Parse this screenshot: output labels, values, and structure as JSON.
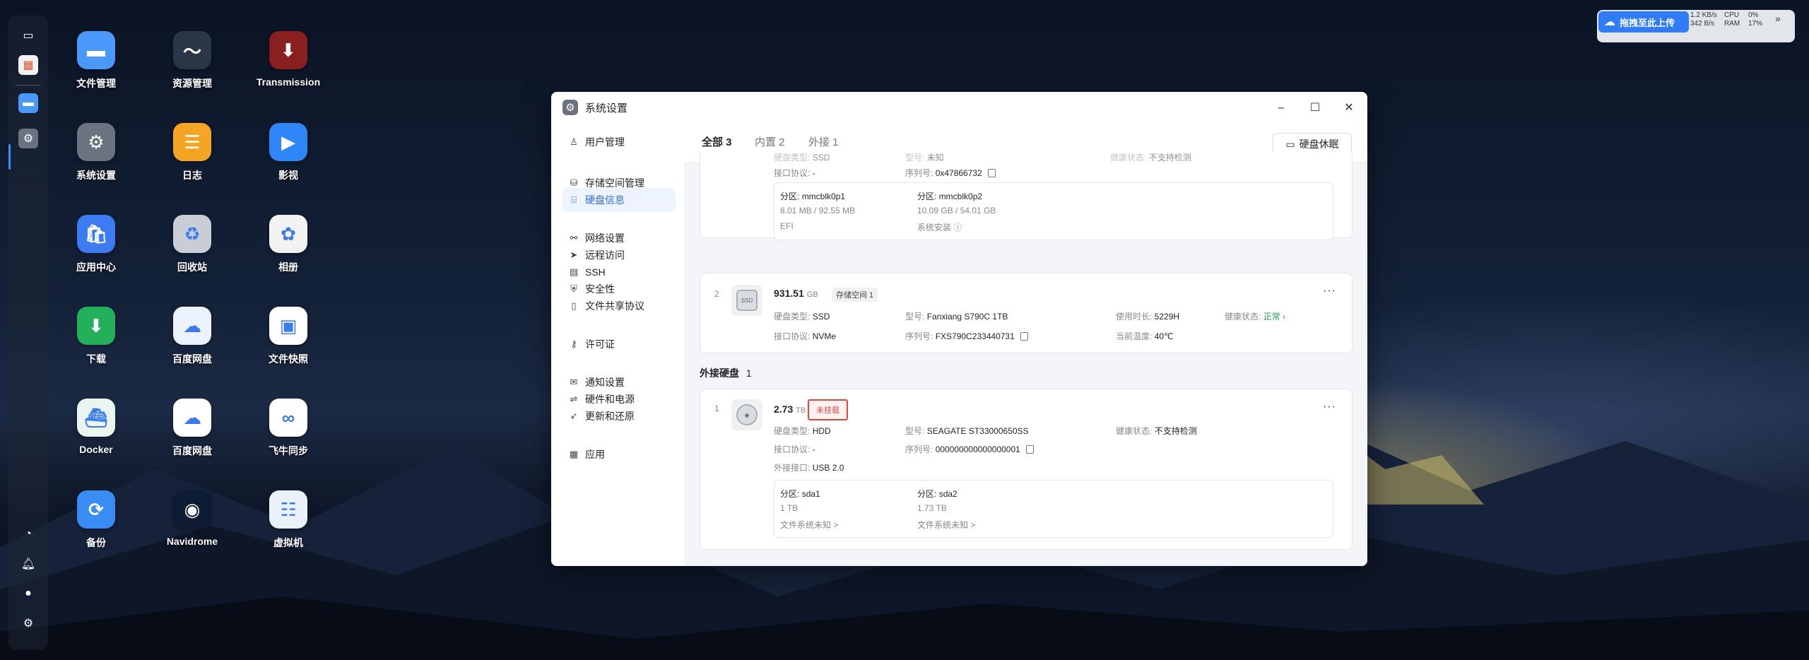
{
  "desktop": {
    "icons": [
      {
        "label": "文件管理",
        "icon": "folder-icon",
        "color": "#4a98f7"
      },
      {
        "label": "资源管理",
        "icon": "activity-monitor-icon",
        "color": "#2a3648"
      },
      {
        "label": "Transmission",
        "icon": "transmission-icon",
        "color": "#8a1f1f"
      },
      {
        "label": "系统设置",
        "icon": "gear-icon",
        "color": "#6b7380"
      },
      {
        "label": "日志",
        "icon": "log-icon",
        "color": "#f4a623"
      },
      {
        "label": "影视",
        "icon": "video-icon",
        "color": "#2f86f6"
      },
      {
        "label": "应用中心",
        "icon": "store-icon",
        "color": "#3d7bf2"
      },
      {
        "label": "回收站",
        "icon": "recycle-bin-icon",
        "color": "#c9ced6"
      },
      {
        "label": "相册",
        "icon": "photos-icon",
        "color": "#f2f2f2"
      },
      {
        "label": "下载",
        "icon": "download-icon",
        "color": "#22b05a"
      },
      {
        "label": "百度网盘",
        "icon": "baidu-netdisk-icon",
        "color": "#eaf3ff"
      },
      {
        "label": "文件快照",
        "icon": "snapshot-icon",
        "color": "#ffffff"
      },
      {
        "label": "Docker",
        "icon": "docker-icon",
        "color": "#e9f5ee"
      },
      {
        "label": "百度网盘",
        "icon": "baidu-netdisk-icon",
        "color": "#ffffff"
      },
      {
        "label": "飞牛同步",
        "icon": "sync-icon",
        "color": "#ffffff"
      },
      {
        "label": "备份",
        "icon": "backup-icon",
        "color": "#3a8cf5"
      },
      {
        "label": "Navidrome",
        "icon": "navidrome-icon",
        "color": "#0d1b33"
      },
      {
        "label": "虚拟机",
        "icon": "vm-icon",
        "color": "#eaf1fb"
      }
    ]
  },
  "upload_widget": {
    "label": "拖拽至此上传",
    "net_up": "1.2 KB/s",
    "net_down": "342 B/s",
    "cpu_label": "CPU",
    "cpu_value": "0%",
    "ram_label": "RAM",
    "ram_value": "17%"
  },
  "window": {
    "title": "系统设置",
    "sidebar": [
      {
        "label": "用户管理",
        "icon": "user-icon"
      },
      {
        "label": "存储空间管理",
        "icon": "storage-icon"
      },
      {
        "label": "硬盘信息",
        "icon": "disk-icon",
        "active": true
      },
      {
        "label": "网络设置",
        "icon": "network-icon"
      },
      {
        "label": "远程访问",
        "icon": "remote-icon"
      },
      {
        "label": "SSH",
        "icon": "terminal-icon"
      },
      {
        "label": "安全性",
        "icon": "shield-icon"
      },
      {
        "label": "文件共享协议",
        "icon": "file-share-icon"
      },
      {
        "label": "许可证",
        "icon": "key-icon"
      },
      {
        "label": "通知设置",
        "icon": "mail-icon"
      },
      {
        "label": "硬件和电源",
        "icon": "power-icon"
      },
      {
        "label": "更新和还原",
        "icon": "rocket-icon"
      },
      {
        "label": "应用",
        "icon": "apps-icon"
      }
    ],
    "tabs": [
      {
        "label": "全部 3",
        "active": true
      },
      {
        "label": "内置 2"
      },
      {
        "label": "外接 1"
      }
    ],
    "sleep_button": "硬盘休眠",
    "disk0": {
      "type_label": "硬盘类型:",
      "type": "SSD",
      "model_label": "型号:",
      "model": "未知",
      "health_label": "健康状态:",
      "health": "不支持检测",
      "iface_label": "接口协议:",
      "iface": "-",
      "serial_label": "序列号:",
      "serial": "0x47866732",
      "partitions": [
        {
          "label": "分区:",
          "name": "mmcblk0p1",
          "size": "8.01 MB / 92.55 MB",
          "fs": "EFI"
        },
        {
          "label": "分区:",
          "name": "mmcblk0p2",
          "size": "10.09 GB / 54.01 GB",
          "fs": "系统安装"
        }
      ]
    },
    "disk2": {
      "index": "2",
      "capacity": "931.51",
      "unit": "GB",
      "pool": "存储空间 1",
      "type_label": "硬盘类型:",
      "type": "SSD",
      "model_label": "型号:",
      "model": "Fanxiang S790C 1TB",
      "hours_label": "使用时长:",
      "hours": "5229H",
      "health_label": "健康状态:",
      "health": "正常",
      "iface_label": "接口协议:",
      "iface": "NVMe",
      "serial_label": "序列号:",
      "serial": "FXS790C233440731",
      "temp_label": "当前温度:",
      "temp": "40℃"
    },
    "external_section": {
      "title": "外接硬盘",
      "count": "1"
    },
    "ext_disk": {
      "index": "1",
      "capacity": "2.73",
      "unit": "TB",
      "status": "未挂载",
      "type_label": "硬盘类型:",
      "type": "HDD",
      "model_label": "型号:",
      "model": "SEAGATE ST33000650SS",
      "health_label": "健康状态:",
      "health": "不支持检测",
      "iface_label": "接口协议:",
      "iface": "-",
      "serial_label": "序列号:",
      "serial": "000000000000000001",
      "ext_iface_label": "外接接口:",
      "ext_iface": "USB 2.0",
      "partitions": [
        {
          "label": "分区:",
          "name": "sda1",
          "size": "1 TB",
          "fs": "文件系统未知 >"
        },
        {
          "label": "分区:",
          "name": "sda2",
          "size": "1.73 TB",
          "fs": "文件系统未知 >"
        }
      ]
    }
  },
  "colors": {
    "accent": "#2f6fe8",
    "healthy": "#1aa34a",
    "warning": "#e8453c"
  }
}
